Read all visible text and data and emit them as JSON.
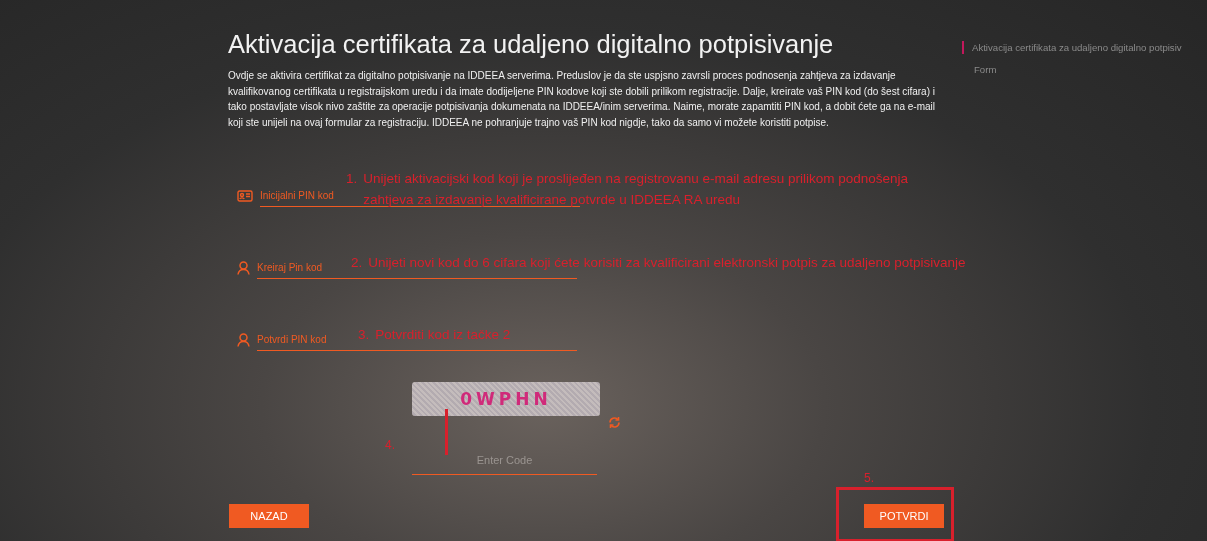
{
  "title": "Aktivacija certifikata za udaljeno digitalno potpisivanje",
  "intro": "Ovdje se aktivira certifikat za digitalno potpisivanje na IDDEEA serverima. Preduslov je da ste uspjsno zavrsli proces podnosenja zahtjeva za izdavanje kvalifikovanog certifikata u registraijskom uredu i da imate dodijeljene PIN kodove koji ste dobili prilikom registracije. Dalje, kreirate vaš PIN kod (do šest cifara) i tako postavljate visok nivo zaštite za operacije potpisivanja dokumenata na IDDEEA/inim serverima. Naime, morate zapamtiti PIN kod, a dobit ćete ga na e-mail koji ste unijeli na ovaj formular za registraciju. IDDEEA ne pohranjuje trajno vaš PIN kod nigdje, tako da samo vi možete koristiti potpise.",
  "sidebar": {
    "title": "Aktivacija certifikata za udaljeno digitalno potpisiv",
    "subtitle": "Form"
  },
  "fields": [
    {
      "kind": "id-card",
      "placeholder": "Inicijalni PIN kod",
      "annotation_number": "1.",
      "annotation": "Unijeti aktivacijski kod koji je proslijeđen na registrovanu e-mail adresu prilikom podnošenja zahtjeva za izdavanje kvalificirane potvrde u IDDEEA RA uredu"
    },
    {
      "kind": "person",
      "placeholder": "Kreiraj Pin kod",
      "annotation_number": "2.",
      "annotation": "Unijeti novi kod do 6 cifara koji ćete korisiti za kvalificirani elektronski potpis za udaljeno potpisivanje"
    },
    {
      "kind": "person",
      "placeholder": "Potvrdi PIN kod",
      "annotation_number": "3.",
      "annotation": "Potvrditi kod iz tačke 2"
    }
  ],
  "captcha": {
    "text": "0WPHN",
    "placeholder": "Enter Code",
    "annotation_number": "4."
  },
  "buttons": [
    {
      "label": "NAZAD"
    },
    {
      "label": "POTVRDI",
      "annotation_number": "5."
    }
  ]
}
